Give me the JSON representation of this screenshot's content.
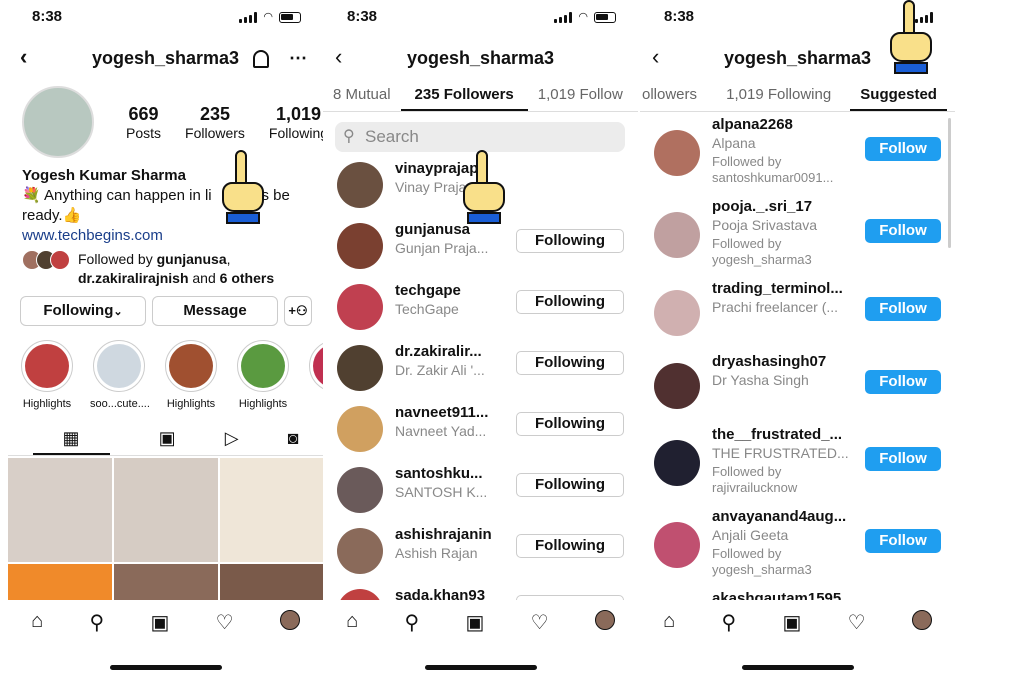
{
  "status": {
    "time": "8:38"
  },
  "colors": {
    "accent": "#1f9ef0",
    "link": "#1a3e8a",
    "text": "#111111",
    "muted": "#888888",
    "hand": "#f9e08a",
    "cuff": "#1a5ed6"
  },
  "panel1": {
    "username": "yogesh_sharma3",
    "stats": [
      {
        "value": "669",
        "label": "Posts"
      },
      {
        "value": "235",
        "label": "Followers"
      },
      {
        "value": "1,019",
        "label": "Following"
      }
    ],
    "name": "Yogesh Kumar Sharma",
    "bio_left": "💐 Anything can happen in li",
    "bio_right": "ays be",
    "bio_line2": "ready.👍",
    "website": "www.techbegins.com",
    "followed_by_prefix": "Followed by ",
    "followed_by_user1": "gunjanusa",
    "followed_by_user2": "dr.zakiralirajnish",
    "followed_by_and": " and ",
    "followed_by_others": "6 others",
    "buttons": {
      "following": "Following",
      "chevron": "⌄",
      "message": "Message"
    },
    "highlights": [
      {
        "label": "Highlights",
        "color": "#c04040"
      },
      {
        "label": "soo...cute....",
        "color": "#cfd8e0"
      },
      {
        "label": "Highlights",
        "color": "#a05030"
      },
      {
        "label": "Highlights",
        "color": "#5a9a40"
      },
      {
        "label": "Highl",
        "color": "#c03050"
      }
    ],
    "tab_icons": [
      "grid-icon",
      "reels-icon",
      "play-icon",
      "tagged-icon"
    ],
    "posts": [
      "#d8cfc8",
      "#d6ccc4",
      "#efe6d8",
      "#f08a2a",
      "#8a6a5a",
      "#7a5a4a"
    ]
  },
  "panel2": {
    "username": "yogesh_sharma3",
    "tabs": [
      "8 Mutual",
      "235 Followers",
      "1,019 Follow"
    ],
    "search_placeholder": "Search",
    "rows": [
      {
        "username": "vinayprajap",
        "fullname": "Vinay Praja",
        "button": "",
        "color": "#6a5040"
      },
      {
        "username": "gunjanusa",
        "fullname": "Gunjan Praja...",
        "button": "Following",
        "color": "#7a4030"
      },
      {
        "username": "techgape",
        "fullname": "TechGape",
        "button": "Following",
        "color": "#c04050"
      },
      {
        "username": "dr.zakiralir...",
        "fullname": "Dr. Zakir Ali '...",
        "button": "Following",
        "color": "#504030"
      },
      {
        "username": "navneet911...",
        "fullname": "Navneet Yad...",
        "button": "Following",
        "color": "#d0a060"
      },
      {
        "username": "santoshku...",
        "fullname": "SANTOSH K...",
        "button": "Following",
        "color": "#6a5a5a"
      },
      {
        "username": "ashishrajanin",
        "fullname": "Ashish Rajan",
        "button": "Following",
        "color": "#8a6a5a"
      },
      {
        "username": "sada.khan93",
        "fullname": "",
        "button": "Following",
        "color": "#c04040"
      }
    ]
  },
  "panel3": {
    "username": "yogesh_sharma3",
    "tabs": [
      "ollowers",
      "1,019 Following",
      "Suggested"
    ],
    "rows": [
      {
        "username": "alpana2268",
        "fullname": "Alpana",
        "followed_label": "Followed by",
        "followed_user": "santoshkumar0091...",
        "button": "Follow",
        "color": "#b07060"
      },
      {
        "username": "pooja._.sri_17",
        "fullname": "Pooja Srivastava",
        "followed_label": "Followed by",
        "followed_user": "yogesh_sharma3",
        "button": "Follow",
        "color": "#c0a0a0"
      },
      {
        "username": "trading_terminol...",
        "fullname": "Prachi freelancer (...",
        "followed_label": "",
        "followed_user": "",
        "button": "Follow",
        "color": "#d0b0b0"
      },
      {
        "username": "dryashasingh07",
        "fullname": "Dr Yasha Singh",
        "followed_label": "",
        "followed_user": "",
        "button": "Follow",
        "color": "#503030"
      },
      {
        "username": "the__frustrated_...",
        "fullname": "THE FRUSTRATED...",
        "followed_label": "Followed by",
        "followed_user": "rajivrailucknow",
        "button": "Follow",
        "color": "#202030"
      },
      {
        "username": "anvayanand4aug...",
        "fullname": "Anjali Geeta",
        "followed_label": "Followed by",
        "followed_user": "yogesh_sharma3",
        "button": "Follow",
        "color": "#c05070"
      },
      {
        "username": "akashgautam1595",
        "fullname": "Akash Gautam",
        "followed_label": "",
        "followed_user": "",
        "button": "Follow",
        "color": "#605050"
      }
    ]
  },
  "nav": [
    "home-icon",
    "search-icon",
    "reels-icon",
    "heart-icon",
    "profile-avatar"
  ]
}
